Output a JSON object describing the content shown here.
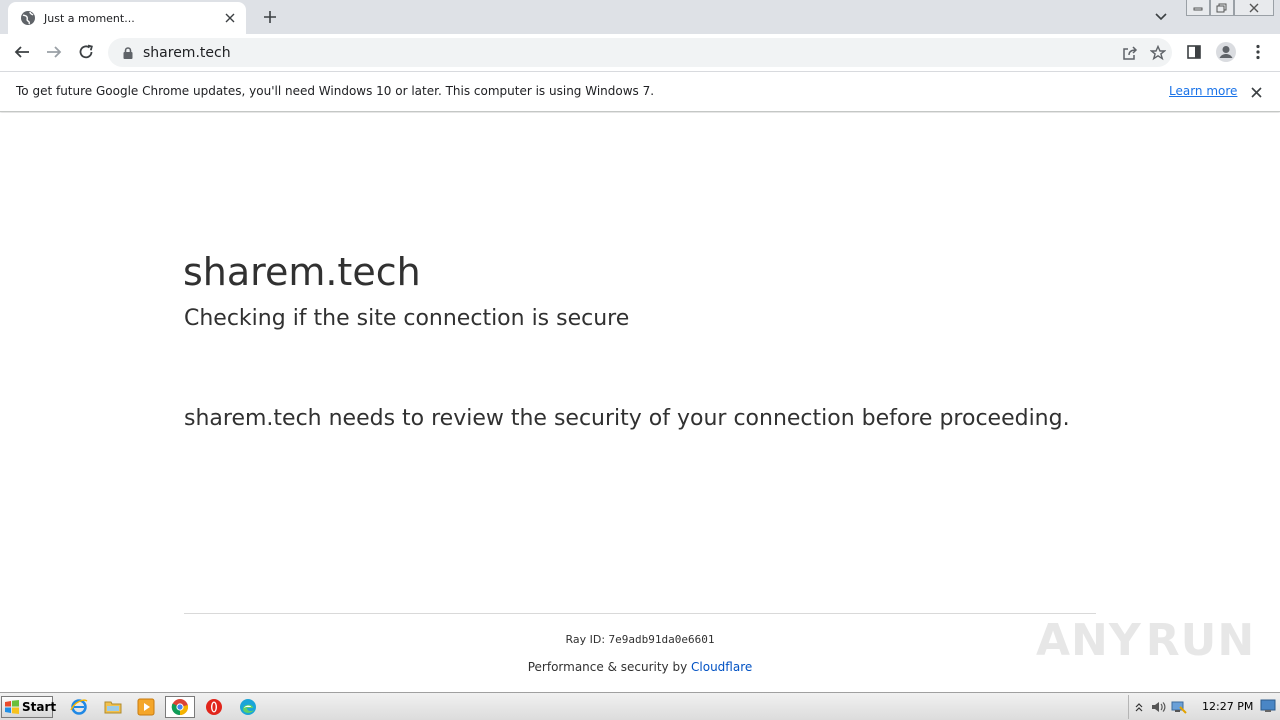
{
  "browser": {
    "tab": {
      "title": "Just a moment..."
    },
    "address_bar": {
      "url": "sharem.tech"
    }
  },
  "infobar": {
    "message": "To get future Google Chrome updates, you'll need Windows 10 or later. This computer is using Windows 7.",
    "link": "Learn more"
  },
  "page": {
    "domain": "sharem.tech",
    "subtitle": "Checking if the site connection is secure",
    "lead": "sharem.tech needs to review the security of your connection before proceeding.",
    "ray_label": "Ray ID: ",
    "ray_id": "7e9adb91da0e6601",
    "performance_label": "Performance & security by ",
    "performance_link": "Cloudflare"
  },
  "watermark": {
    "left": "ANY",
    "right": "RUN"
  },
  "taskbar": {
    "start_label": "Start",
    "clock": "12:27 PM"
  },
  "colors": {
    "link_blue": "#1a73e8",
    "cloudflare_blue": "#0051c3",
    "text": "#313131",
    "tabstrip": "#dee1e6"
  }
}
